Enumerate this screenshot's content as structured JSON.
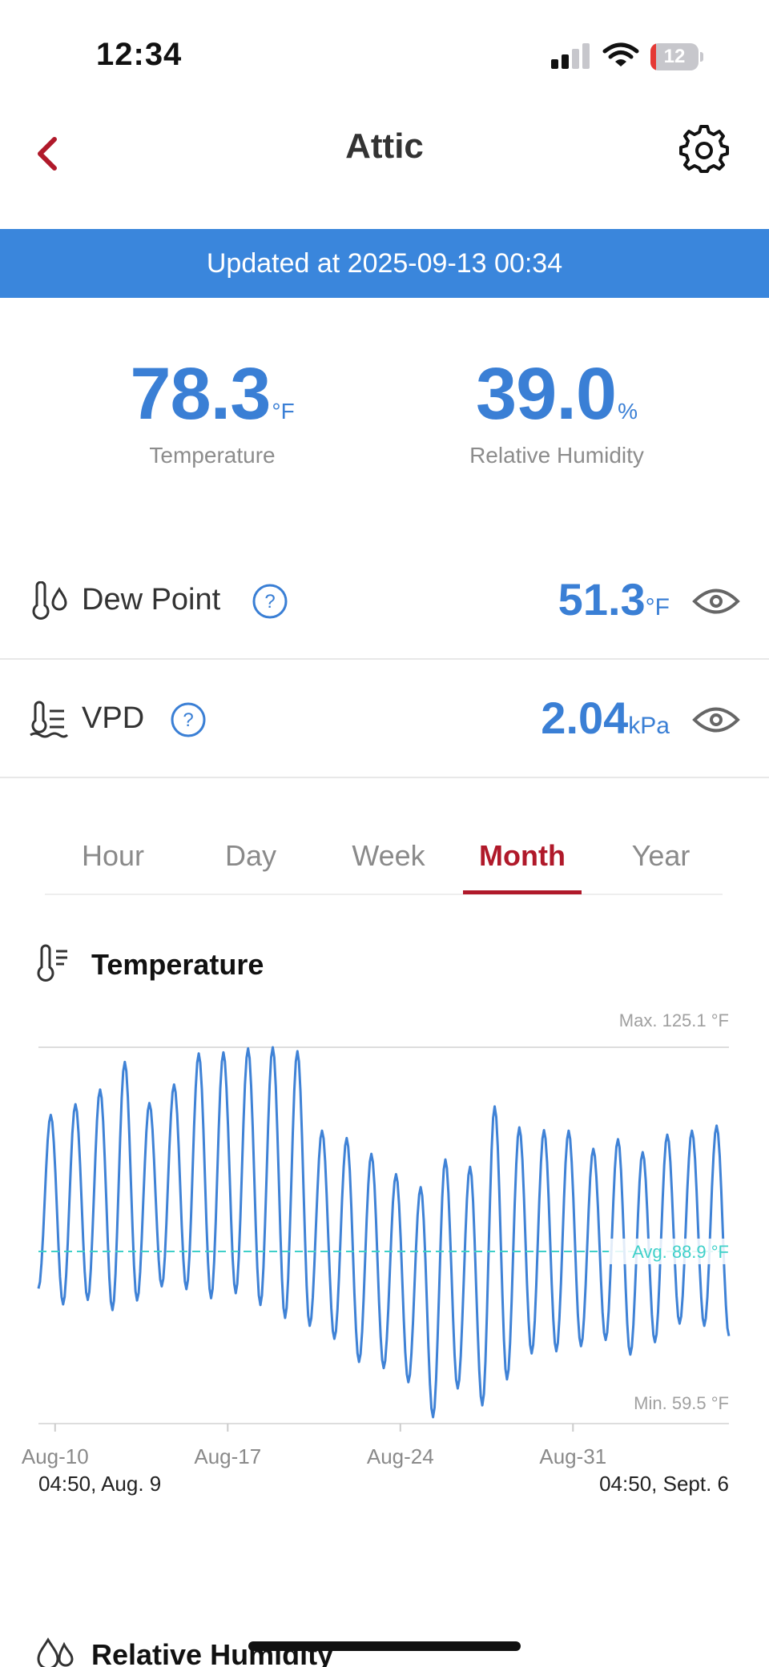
{
  "status_bar": {
    "time": "12:34",
    "battery": "12",
    "battery_level": 0.12
  },
  "nav": {
    "title": "Attic"
  },
  "banner": {
    "text": "Updated at 2025-09-13 00:34"
  },
  "readings": {
    "temperature": {
      "value": "78.3",
      "unit": "°F",
      "label": "Temperature"
    },
    "humidity": {
      "value": "39.0",
      "unit": "%",
      "label": "Relative Humidity"
    }
  },
  "metrics": [
    {
      "label": "Dew Point",
      "value": "51.3",
      "unit": "°F"
    },
    {
      "label": "VPD",
      "value": "2.04",
      "unit": "kPa"
    }
  ],
  "tabs": [
    {
      "label": "Hour"
    },
    {
      "label": "Day"
    },
    {
      "label": "Week"
    },
    {
      "label": "Month",
      "active": true
    },
    {
      "label": "Year"
    }
  ],
  "temperature_section": {
    "title": "Temperature"
  },
  "humidity_section": {
    "title": "Relative Humidity"
  },
  "colors": {
    "accent": "#3a7fd5",
    "banner": "#3a86dc",
    "active_tab": "#b0192a",
    "avg_line": "#3fd0c9"
  },
  "chart_data": {
    "type": "line",
    "title": "Temperature",
    "max_label": "Max. 125.1 °F",
    "min_label": "Min. 59.5 °F",
    "avg_label": "Avg. 88.9 °F",
    "max": 125.1,
    "min": 59.5,
    "avg": 88.9,
    "x_ticks": [
      "Aug-10",
      "Aug-17",
      "Aug-24",
      "Aug-31"
    ],
    "start_label": "04:50, Aug. 9",
    "end_label": "04:50, Sept. 6",
    "grid": false,
    "series": [
      {
        "daily_high": [
          113.1,
          115.0,
          117.6,
          122.5,
          115.2,
          118.5,
          124.0,
          124.2,
          124.9,
          125.1,
          124.4,
          110.3,
          109.0,
          106.2,
          102.6,
          100.3,
          105.2,
          103.9,
          114.6,
          110.9,
          110.4,
          110.3,
          107.1,
          108.8,
          106.5,
          109.6,
          110.3,
          111.2,
          109.4
        ],
        "daily_low": [
          82.3,
          79.5,
          80.3,
          78.5,
          80.2,
          82.7,
          82.2,
          80.6,
          81.5,
          79.4,
          77.1,
          75.7,
          73.4,
          69.3,
          68.2,
          65.7,
          59.5,
          64.6,
          61.6,
          66.2,
          70.8,
          71.2,
          72.1,
          73.2,
          70.6,
          72.8,
          76.1,
          75.7,
          73.9
        ]
      }
    ]
  }
}
